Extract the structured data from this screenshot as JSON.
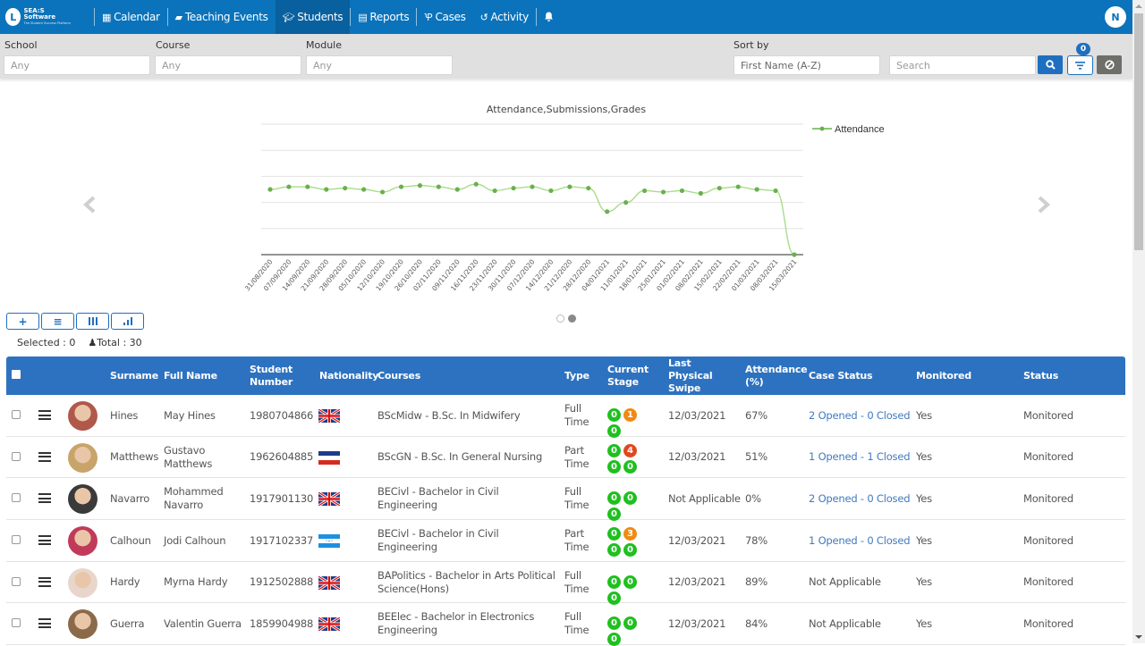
{
  "app": {
    "logo_brand": "SEA:S Software",
    "logo_tagline": "The Student Success Platform",
    "user_initial": "N"
  },
  "nav": {
    "items": [
      {
        "label": "Calendar",
        "icon": "calendar-icon",
        "active": false
      },
      {
        "label": "Teaching Events",
        "icon": "book-icon",
        "active": false
      },
      {
        "label": "Students",
        "icon": "graduation-cap-icon",
        "active": true
      },
      {
        "label": "Reports",
        "icon": "document-icon",
        "active": false
      },
      {
        "label": "Cases",
        "icon": "cases-icon",
        "active": false
      },
      {
        "label": "Activity",
        "icon": "history-icon",
        "active": false
      }
    ],
    "bell_icon": "bell-icon"
  },
  "filters": {
    "school": {
      "label": "School",
      "placeholder": "Any"
    },
    "course": {
      "label": "Course",
      "placeholder": "Any"
    },
    "module": {
      "label": "Module",
      "placeholder": "Any"
    },
    "sort": {
      "label": "Sort by",
      "value": "First Name (A-Z)"
    },
    "search": {
      "placeholder": "Search"
    },
    "filter_count": "0"
  },
  "chart_data": {
    "type": "line",
    "title": "Attendance,Submissions,Grades",
    "xlabel": "",
    "ylabel": "",
    "ylim": [
      0,
      100
    ],
    "grid": true,
    "legend": "top-right",
    "x": [
      "31/08/2020",
      "07/09/2020",
      "14/09/2020",
      "21/09/2020",
      "28/09/2020",
      "05/10/2020",
      "12/10/2020",
      "19/10/2020",
      "26/10/2020",
      "02/11/2020",
      "09/11/2020",
      "16/11/2020",
      "23/11/2020",
      "30/11/2020",
      "07/12/2020",
      "14/12/2020",
      "21/12/2020",
      "28/12/2020",
      "04/01/2021",
      "11/01/2021",
      "18/01/2021",
      "25/01/2021",
      "01/02/2021",
      "08/02/2021",
      "15/02/2021",
      "22/02/2021",
      "01/03/2021",
      "08/03/2021",
      "15/03/2021"
    ],
    "series": [
      {
        "name": "Attendance",
        "color": "#6ab04c",
        "values": [
          50,
          52,
          52,
          50,
          51,
          50,
          48,
          52,
          53,
          52,
          50,
          54,
          49,
          51,
          52,
          49,
          52,
          51,
          33,
          40,
          49,
          48,
          49,
          47,
          51,
          52,
          50,
          49,
          0
        ]
      }
    ]
  },
  "carousel": {
    "pages": 2,
    "active_page": 2
  },
  "toolbar": {
    "buttons": [
      {
        "name": "add-button",
        "glyph": "+"
      },
      {
        "name": "list-view-button",
        "glyph": "≡"
      },
      {
        "name": "columns-button",
        "glyph": "|||"
      },
      {
        "name": "chart-button",
        "glyph": "chart"
      }
    ]
  },
  "counts": {
    "selected": "Selected : 0",
    "total": "Total : 30"
  },
  "table": {
    "headers": {
      "surname": "Surname",
      "full_name": "Full Name",
      "student_number": "Student Number",
      "nationality": "Nationality",
      "courses": "Courses",
      "type": "Type",
      "current_stage": "Current Stage",
      "last_swipe": "Last Physical Swipe",
      "attendance": "Attendance (%)",
      "case_status": "Case Status",
      "monitored": "Monitored",
      "status": "Status"
    },
    "rows": [
      {
        "surname": "Hines",
        "full_name": "May Hines",
        "student_number": "1980704866",
        "nationality": "GB",
        "course": "BScMidw - B.Sc. In Midwifery",
        "type": "Full Time",
        "stages": [
          {
            "v": "0",
            "c": "green"
          },
          {
            "v": "1",
            "c": "orange"
          },
          {
            "v": "0",
            "c": "green"
          }
        ],
        "last_swipe": "12/03/2021",
        "attendance": "67%",
        "case_status": "2 Opened - 0 Closed",
        "case_link": true,
        "monitored": "Yes",
        "status": "Monitored"
      },
      {
        "surname": "Matthews",
        "full_name": "Gustavo Matthews",
        "student_number": "1962604885",
        "nationality": "PY",
        "course": "BScGN - B.Sc. In General Nursing",
        "type": "Part Time",
        "stages": [
          {
            "v": "0",
            "c": "green"
          },
          {
            "v": "4",
            "c": "red"
          },
          {
            "v": "0",
            "c": "green"
          },
          {
            "v": "0",
            "c": "green"
          }
        ],
        "last_swipe": "12/03/2021",
        "attendance": "51%",
        "case_status": "1 Opened - 1 Closed",
        "case_link": true,
        "monitored": "Yes",
        "status": "Monitored"
      },
      {
        "surname": "Navarro",
        "full_name": "Mohammed Navarro",
        "student_number": "1917901130",
        "nationality": "GB",
        "course": "BECivl - Bachelor in Civil Engineering",
        "type": "Full Time",
        "stages": [
          {
            "v": "0",
            "c": "green"
          },
          {
            "v": "0",
            "c": "green"
          },
          {
            "v": "0",
            "c": "green"
          }
        ],
        "last_swipe": "Not Applicable",
        "attendance": "0%",
        "case_status": "2 Opened - 0 Closed",
        "case_link": true,
        "monitored": "Yes",
        "status": "Monitored"
      },
      {
        "surname": "Calhoun",
        "full_name": "Jodi Calhoun",
        "student_number": "1917102337",
        "nationality": "HN",
        "course": "BECivl - Bachelor in Civil Engineering",
        "type": "Part Time",
        "stages": [
          {
            "v": "0",
            "c": "green"
          },
          {
            "v": "3",
            "c": "orange"
          },
          {
            "v": "0",
            "c": "green"
          },
          {
            "v": "0",
            "c": "green"
          }
        ],
        "last_swipe": "12/03/2021",
        "attendance": "78%",
        "case_status": "1 Opened - 0 Closed",
        "case_link": true,
        "monitored": "Yes",
        "status": "Monitored"
      },
      {
        "surname": "Hardy",
        "full_name": "Myrna Hardy",
        "student_number": "1912502888",
        "nationality": "GB",
        "course": "BAPolitics - Bachelor in Arts Political Science(Hons)",
        "type": "Full Time",
        "stages": [
          {
            "v": "0",
            "c": "green"
          },
          {
            "v": "0",
            "c": "green"
          },
          {
            "v": "0",
            "c": "green"
          }
        ],
        "last_swipe": "12/03/2021",
        "attendance": "89%",
        "case_status": "Not Applicable",
        "case_link": false,
        "monitored": "Yes",
        "status": "Monitored"
      },
      {
        "surname": "Guerra",
        "full_name": "Valentin Guerra",
        "student_number": "1859904988",
        "nationality": "GB",
        "course": "BEElec - Bachelor in Electronics Engineering",
        "type": "Full Time",
        "stages": [
          {
            "v": "0",
            "c": "green"
          },
          {
            "v": "0",
            "c": "green"
          },
          {
            "v": "0",
            "c": "green"
          }
        ],
        "last_swipe": "12/03/2021",
        "attendance": "84%",
        "case_status": "Not Applicable",
        "case_link": false,
        "monitored": "Yes",
        "status": "Monitored"
      }
    ]
  },
  "colors": {
    "brand": "#0a73bb",
    "table_header": "#2d72c0",
    "stage_green": "#1fbf1f",
    "stage_orange": "#f08a12",
    "stage_red": "#e2461e",
    "link": "#3f7ac0",
    "chart_line": "#6ab04c"
  }
}
